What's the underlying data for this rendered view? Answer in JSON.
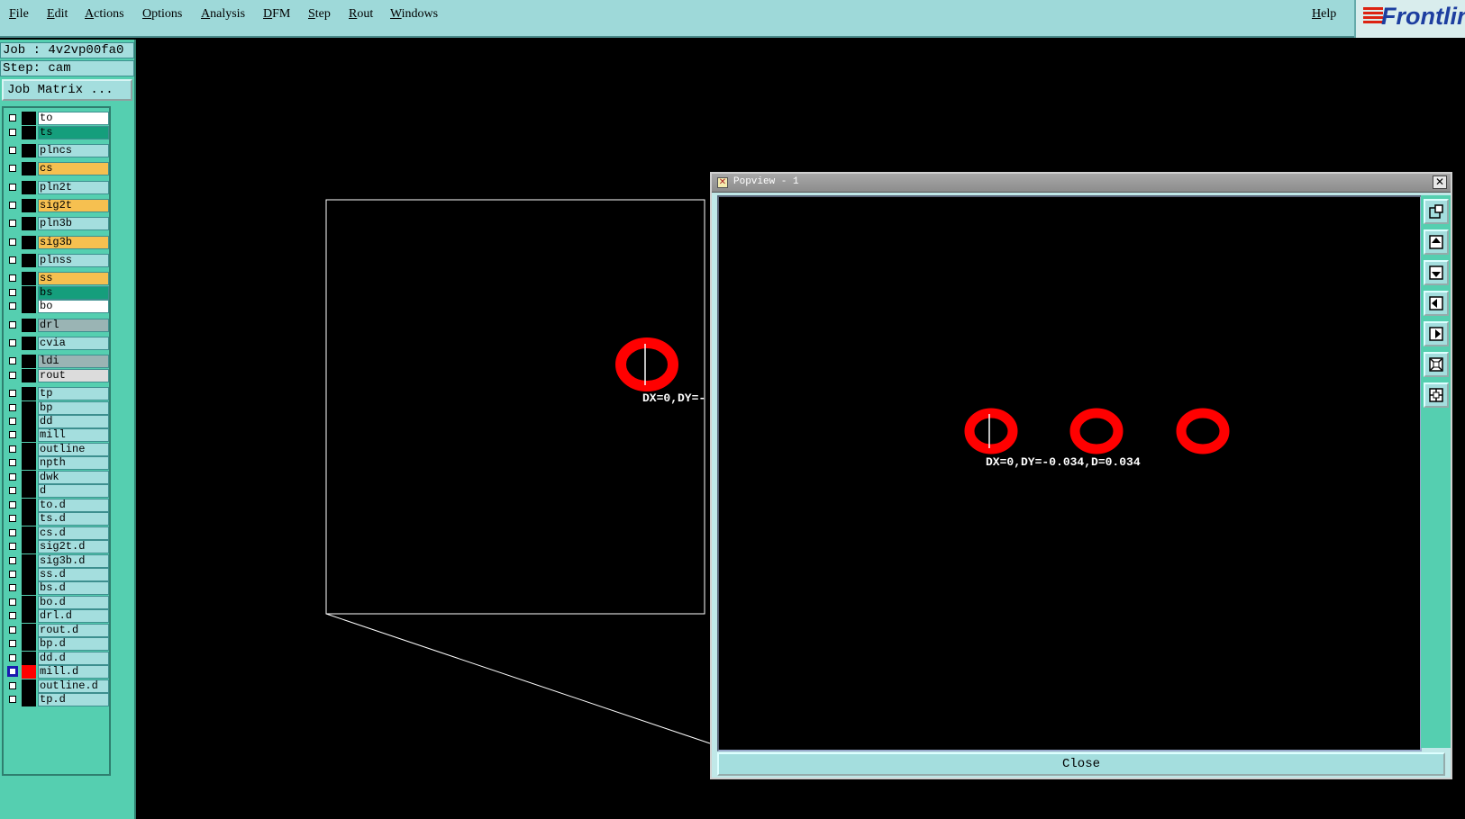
{
  "menubar": {
    "items": [
      "File",
      "Edit",
      "Actions",
      "Options",
      "Analysis",
      "DFM",
      "Step",
      "Rout",
      "Windows"
    ],
    "help": "Help",
    "logo": "Frontline"
  },
  "left_panel": {
    "job": "Job : 4v2vp00fa0",
    "step": "Step: cam",
    "job_matrix": "Job Matrix ..."
  },
  "layers": [
    {
      "name": "to",
      "color": "#ffffff",
      "mark": ""
    },
    {
      "name": "ts",
      "color": "#159e7c",
      "mark": ""
    },
    {
      "name": "plncs",
      "color": "#a4dede",
      "mark": ""
    },
    {
      "name": "cs",
      "color": "#f6c050",
      "mark": ""
    },
    {
      "name": "pln2t",
      "color": "#a4dede",
      "mark": ""
    },
    {
      "name": "sig2t",
      "color": "#f6c050",
      "mark": "brush"
    },
    {
      "name": "pln3b",
      "color": "#a4dede",
      "mark": ""
    },
    {
      "name": "sig3b",
      "color": "#f6c050",
      "mark": "brush"
    },
    {
      "name": "plnss",
      "color": "#a4dede",
      "mark": ""
    },
    {
      "name": "ss",
      "color": "#f6c050",
      "mark": "brush"
    },
    {
      "name": "bs",
      "color": "#159e7c",
      "mark": ""
    },
    {
      "name": "bo",
      "color": "#ffffff",
      "mark": ""
    },
    {
      "name": "drl",
      "color": "#9ab4b4",
      "mark": ""
    },
    {
      "name": "cvia",
      "color": "#a4dede",
      "mark": ""
    },
    {
      "name": "ldi",
      "color": "#9ab4b4",
      "mark": ""
    },
    {
      "name": "rout",
      "color": "#dcdcdc",
      "mark": ""
    },
    {
      "name": "tp",
      "color": "#a4dede",
      "mark": ""
    },
    {
      "name": "bp",
      "color": "#a4dede",
      "mark": ""
    },
    {
      "name": "dd",
      "color": "#a4dede",
      "mark": ""
    },
    {
      "name": "mill",
      "color": "#a4dede",
      "mark": ""
    },
    {
      "name": "outline",
      "color": "#a4dede",
      "mark": ""
    },
    {
      "name": "npth",
      "color": "#a4dede",
      "mark": ""
    },
    {
      "name": "dwk",
      "color": "#a4dede",
      "mark": ""
    },
    {
      "name": "d",
      "color": "#a4dede",
      "mark": ""
    },
    {
      "name": "to.d",
      "color": "#a4dede",
      "mark": ""
    },
    {
      "name": "ts.d",
      "color": "#a4dede",
      "mark": ""
    },
    {
      "name": "cs.d",
      "color": "#a4dede",
      "mark": ""
    },
    {
      "name": "sig2t.d",
      "color": "#a4dede",
      "mark": "brush"
    },
    {
      "name": "sig3b.d",
      "color": "#a4dede",
      "mark": "brush"
    },
    {
      "name": "ss.d",
      "color": "#a4dede",
      "mark": "brush"
    },
    {
      "name": "bs.d",
      "color": "#a4dede",
      "mark": ""
    },
    {
      "name": "bo.d",
      "color": "#a4dede",
      "mark": ""
    },
    {
      "name": "drl.d",
      "color": "#a4dede",
      "mark": ""
    },
    {
      "name": "rout.d",
      "color": "#a4dede",
      "mark": ""
    },
    {
      "name": "bp.d",
      "color": "#a4dede",
      "mark": ""
    },
    {
      "name": "dd.d",
      "color": "#a4dede",
      "mark": ""
    },
    {
      "name": "mill.d",
      "color": "#a4dede",
      "mark": "grid",
      "active": true
    },
    {
      "name": "outline.d",
      "color": "#a4dede",
      "mark": ""
    },
    {
      "name": "tp.d",
      "color": "#a4dede",
      "mark": ""
    }
  ],
  "main_view": {
    "measure_label": "DX=0,DY=-"
  },
  "popview": {
    "title": "Popview - 1",
    "measure_label": "DX=0,DY=-0.034,D=0.034",
    "close": "Close",
    "tools": [
      "zoom-window-icon",
      "pan-up-icon",
      "pan-down-icon",
      "pan-left-icon",
      "pan-right-icon",
      "zoom-fit-icon",
      "zoom-center-icon"
    ]
  }
}
